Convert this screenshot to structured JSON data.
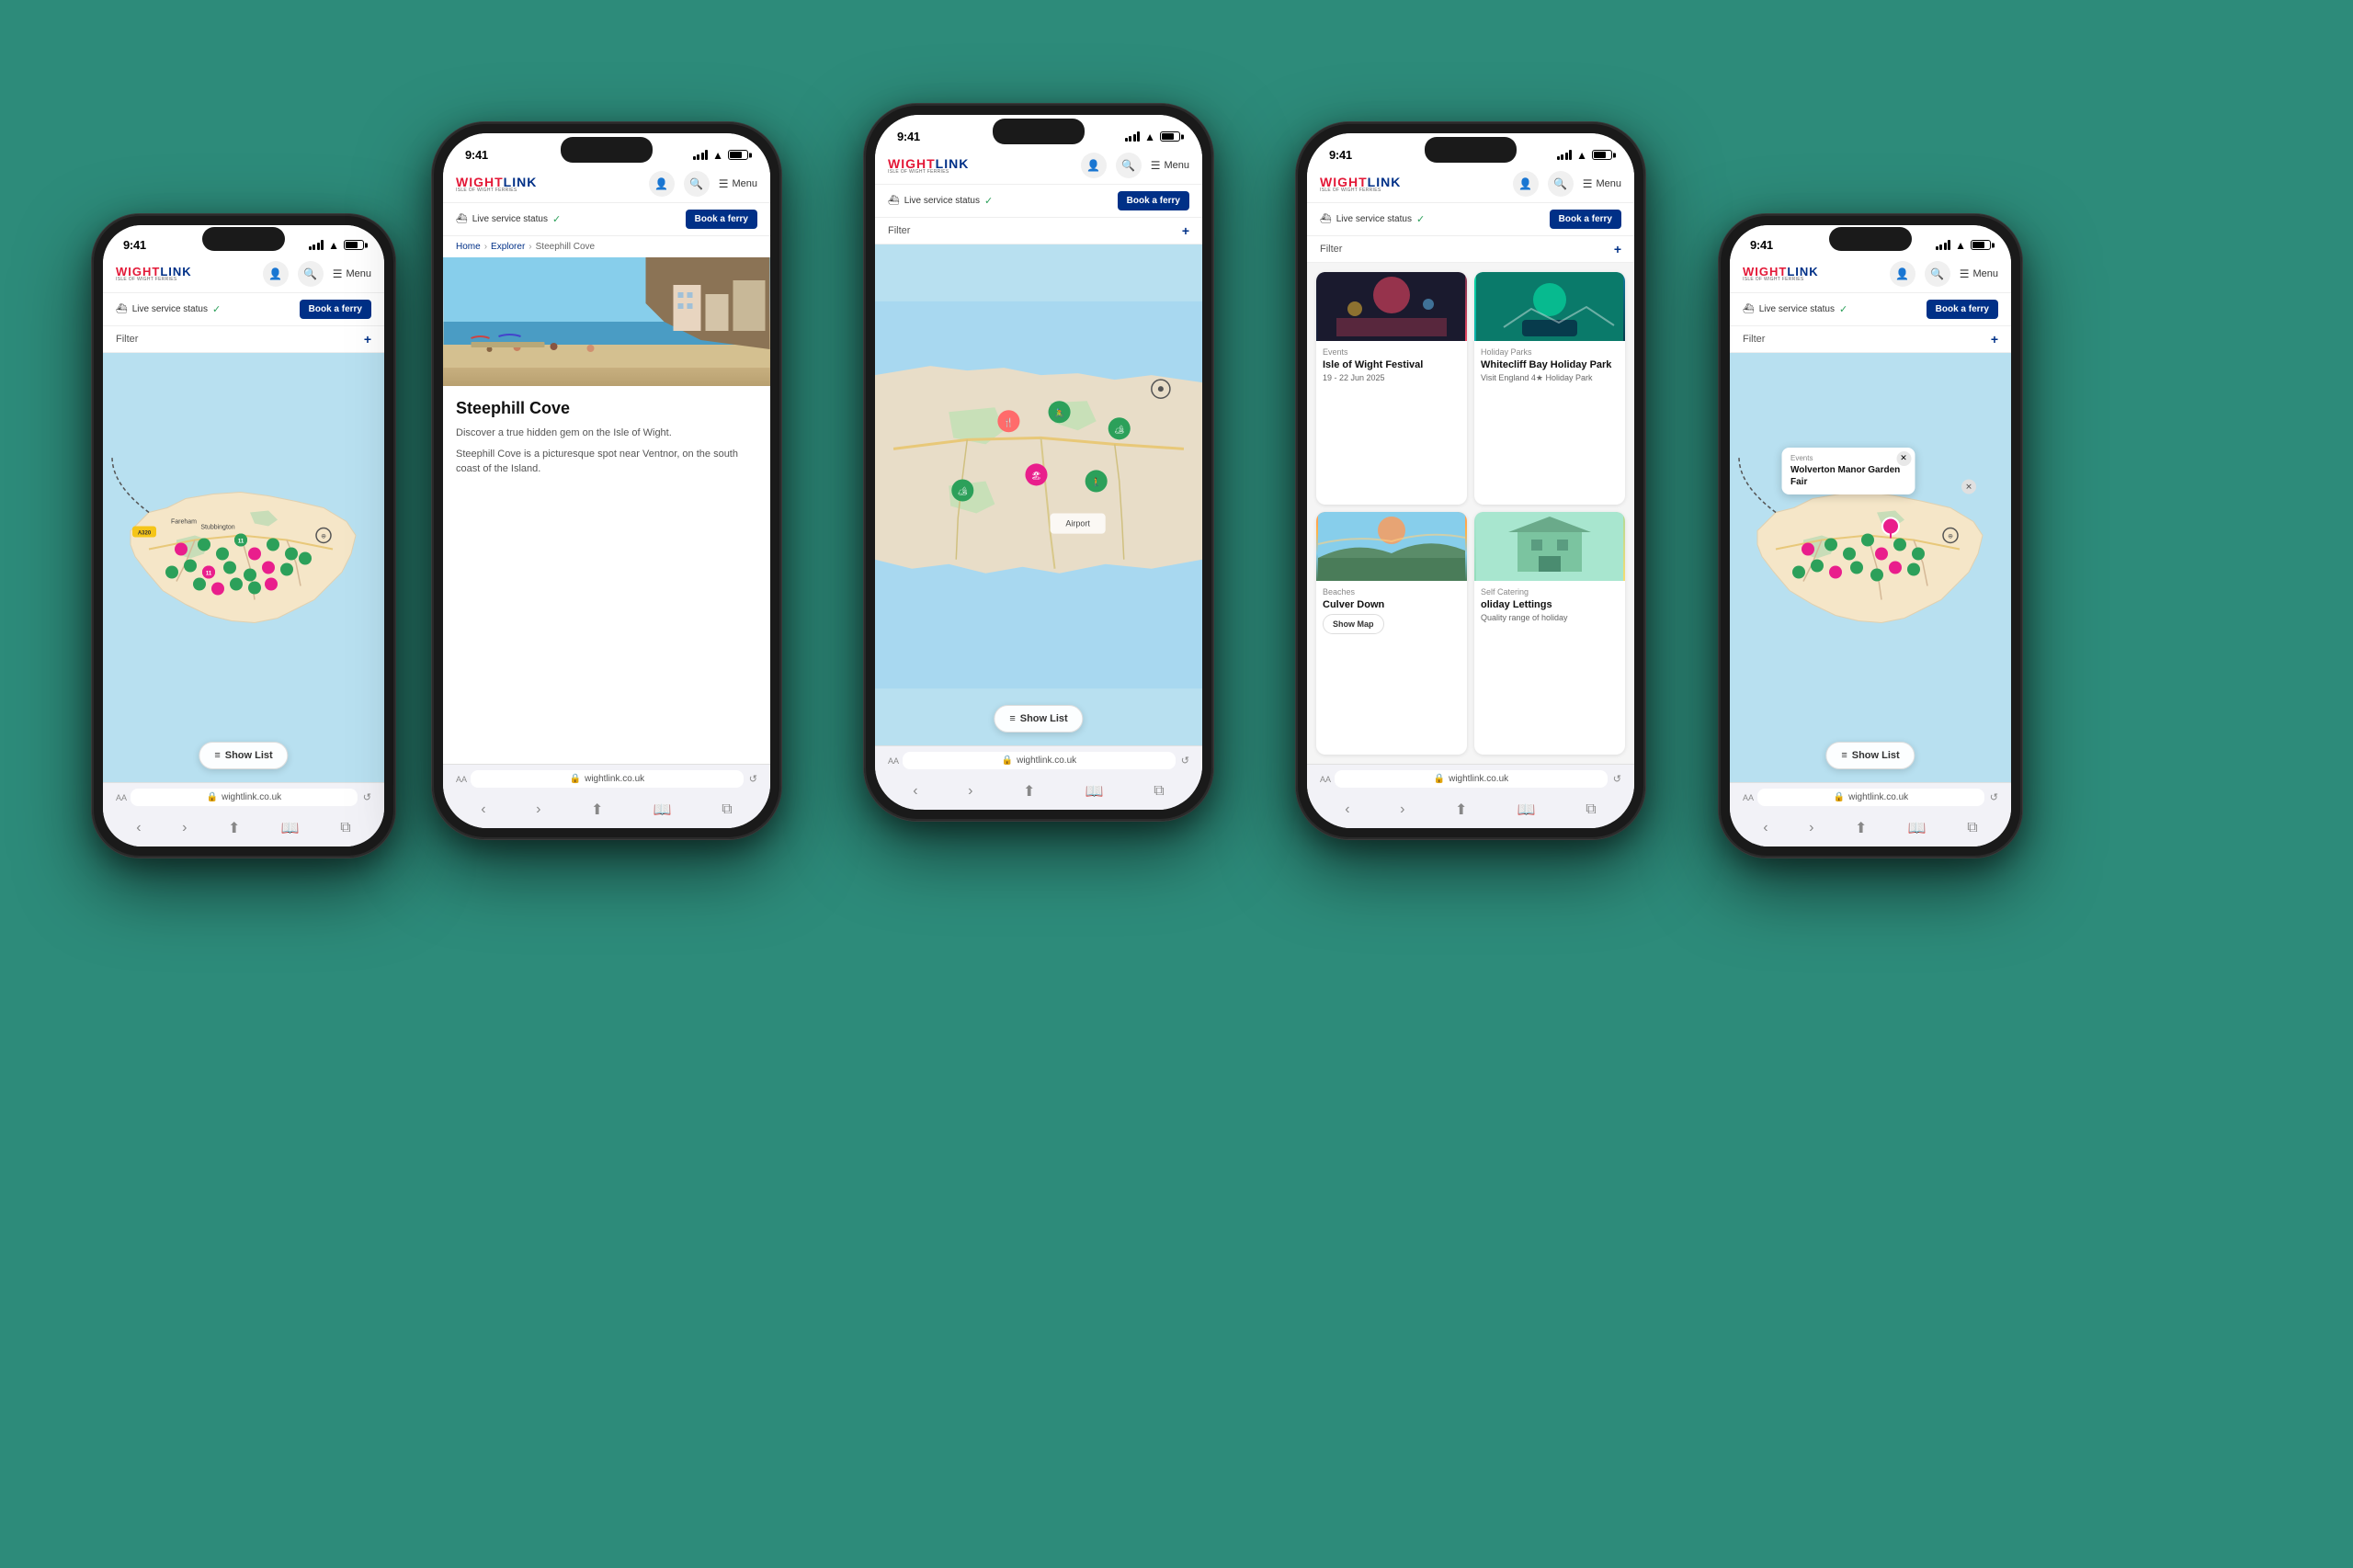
{
  "background_color": "#2d8b7a",
  "phones": [
    {
      "id": "p1",
      "position": "left-back",
      "size": "small",
      "screen_type": "map",
      "status_bar": {
        "time": "9:41",
        "signal": "full",
        "wifi": true,
        "battery": 75
      },
      "nav": {
        "logo_text": "WIGHTLINK",
        "logo_sub": "ISLE OF WIGHT FERRIES",
        "menu_label": "Menu"
      },
      "banner": {
        "service_status": "Live service status",
        "book_ferry": "Book a ferry"
      },
      "filter": {
        "label": "Filter",
        "add_icon": "+"
      },
      "show_list_btn": "Show List",
      "browser_url": "wightlink.co.uk"
    },
    {
      "id": "p2",
      "position": "left-front",
      "size": "large",
      "screen_type": "detail",
      "status_bar": {
        "time": "9:41",
        "signal": "full",
        "wifi": true,
        "battery": 75
      },
      "nav": {
        "logo_text": "WIGHTLINK",
        "logo_sub": "ISLE OF WIGHT FERRIES",
        "menu_label": "Menu"
      },
      "banner": {
        "service_status": "Live service status",
        "book_ferry": "Book a ferry"
      },
      "breadcrumb": [
        "Home",
        "Explorer",
        "Steephill Cove"
      ],
      "detail_title": "Steephill Cove",
      "detail_desc1": "Discover a true hidden gem on the Isle of Wight.",
      "detail_desc2": "Steephill Cove is a picturesque spot near Ventnor, on the south coast of the Island.",
      "browser_url": "wightlink.co.uk"
    },
    {
      "id": "p3",
      "position": "center",
      "size": "large",
      "screen_type": "map-detail",
      "status_bar": {
        "time": "9:41",
        "signal": "full",
        "wifi": true,
        "battery": 75
      },
      "nav": {
        "logo_text": "WIGHTLINK",
        "logo_sub": "ISLE OF WIGHT FERRIES",
        "menu_label": "Menu"
      },
      "banner": {
        "service_status": "Live service status",
        "book_ferry": "Book a ferry"
      },
      "filter": {
        "label": "Filter",
        "add_icon": "+"
      },
      "show_list_btn": "Show List",
      "browser_url": "wightlink.co.uk"
    },
    {
      "id": "p4",
      "position": "right-front",
      "size": "large",
      "screen_type": "cards",
      "status_bar": {
        "time": "9:41",
        "signal": "full",
        "wifi": true,
        "battery": 75
      },
      "nav": {
        "logo_text": "WIGHTLINK",
        "logo_sub": "ISLE OF WIGHT FERRIES",
        "menu_label": "Menu"
      },
      "banner": {
        "service_status": "Live service status",
        "book_ferry": "Book a ferry"
      },
      "filter": {
        "label": "Filter",
        "add_icon": "+"
      },
      "cards": [
        {
          "category": "Events",
          "title": "Isle of Wight Festival",
          "meta": "19 - 22 Jun 2025",
          "img_class": "img-festival"
        },
        {
          "category": "Holiday Parks",
          "title": "Whitecliff Bay Holiday Park",
          "meta": "Visit England 4★ Holiday Park",
          "img_class": "img-holiday-park"
        },
        {
          "category": "Beaches",
          "title": "Culver Down",
          "meta": "",
          "img_class": "img-culver",
          "show_map_btn": "Show Map"
        },
        {
          "category": "Self Catering",
          "title": "oliday Lettings",
          "meta": "Quality range of holiday",
          "img_class": "img-self-catering"
        }
      ],
      "browser_url": "wightlink.co.uk"
    },
    {
      "id": "p5",
      "position": "right-back",
      "size": "small",
      "screen_type": "map-popup",
      "status_bar": {
        "time": "9:41",
        "signal": "full",
        "wifi": true,
        "battery": 75
      },
      "nav": {
        "logo_text": "WIGHTLINK",
        "logo_sub": "ISLE OF WIGHT FERRIES",
        "menu_label": "Menu"
      },
      "banner": {
        "service_status": "Live service status",
        "book_ferry": "Book a ferry"
      },
      "filter": {
        "label": "Filter",
        "add_icon": "+"
      },
      "popup": {
        "category": "Events",
        "title": "Wolverton Manor Garden Fair"
      },
      "show_list_btn": "Show List",
      "browser_url": "wightlink.co.uk"
    }
  ]
}
